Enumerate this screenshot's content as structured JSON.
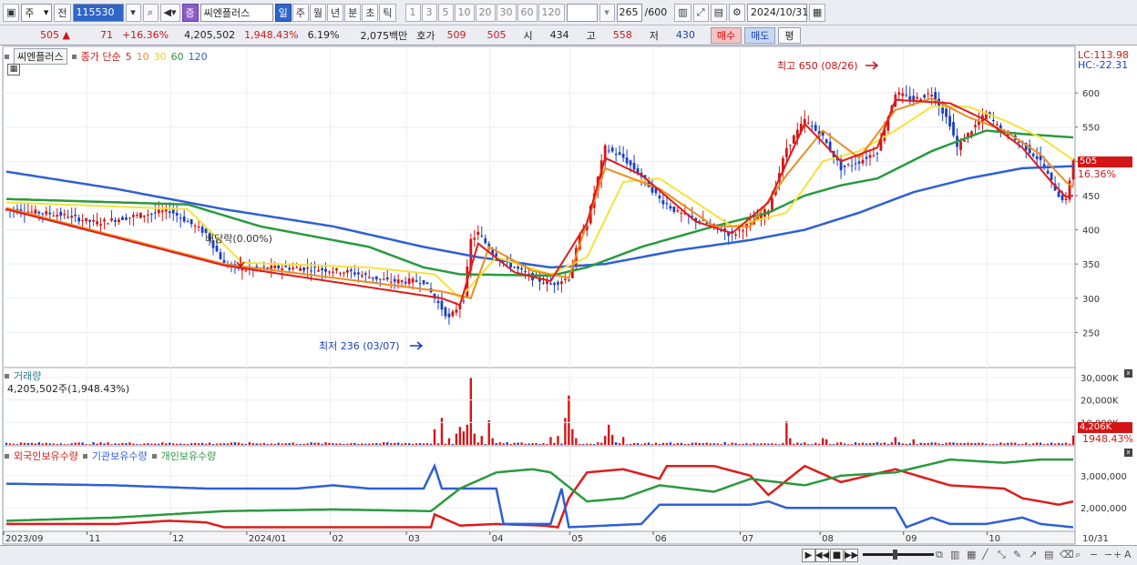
{
  "toolbar": {
    "period_dropdown": "주",
    "prev_label": "전",
    "stock_code": "115530",
    "stock_name": "씨엔플러스",
    "stock_tag": "증",
    "intervals": [
      "일",
      "주",
      "월",
      "년",
      "분",
      "초",
      "틱"
    ],
    "active_interval": "일",
    "ticks": [
      "1",
      "3",
      "5",
      "10",
      "20",
      "30",
      "60",
      "120"
    ],
    "count": "265",
    "count_max": "/600",
    "date": "2024/10/31"
  },
  "quote": {
    "price": "505",
    "change_arrow": "▲",
    "change": "71",
    "change_pct": "+16.36%",
    "volume": "4,205,502",
    "volume_pct": "1,948.43%",
    "turnover_pct": "6.19%",
    "amount": "2,075백만",
    "hoga_label": "호가",
    "hoga_ask": "509",
    "hoga_bid": "505",
    "open_label": "시",
    "open": "434",
    "high_label": "고",
    "high": "558",
    "low_label": "저",
    "low": "430",
    "buy_label": "매수",
    "sell_label": "매도",
    "eval_label": "평"
  },
  "colors": {
    "up": "#d41515",
    "down": "#1a3fc2",
    "ma5": "#e01b1b",
    "ma10": "#f08c1e",
    "ma30": "#f5e23a",
    "ma60": "#2a9a3e",
    "ma120": "#2f5fd6",
    "foreign": "#e01b1b",
    "institution": "#2f5fd6",
    "individual": "#2a9a3e"
  },
  "chart_data": [
    {
      "type": "candlestick",
      "title": "씨엔플러스",
      "legend_label": "종가 단순",
      "ma_periods": [
        "5",
        "10",
        "30",
        "60",
        "120"
      ],
      "x_ticks": [
        "2023/09",
        "11",
        "12",
        "2024/01",
        "02",
        "03",
        "04",
        "05",
        "06",
        "07",
        "08",
        "09",
        "10",
        "10/31"
      ],
      "y_ticks": [
        250,
        300,
        350,
        400,
        450,
        500,
        550,
        600
      ],
      "ylim": [
        200,
        660
      ],
      "side_labels": {
        "lc": "LC:113.98",
        "hc": "HC:-22.31",
        "last_price": "505",
        "last_pct": "16.36%"
      },
      "annotations": {
        "high": "최고 650 (08/26)",
        "low": "최저 236 (03/07)",
        "dividend": "배당락(0.00%)"
      },
      "close_anchors": [
        [
          0,
          430
        ],
        [
          15,
          422
        ],
        [
          25,
          410
        ],
        [
          35,
          420
        ],
        [
          45,
          428
        ],
        [
          55,
          395
        ],
        [
          60,
          350
        ],
        [
          65,
          342
        ],
        [
          75,
          345
        ],
        [
          85,
          343
        ],
        [
          95,
          338
        ],
        [
          105,
          325
        ],
        [
          115,
          325
        ],
        [
          118,
          300
        ],
        [
          122,
          270
        ],
        [
          126,
          300
        ],
        [
          128,
          385
        ],
        [
          130,
          395
        ],
        [
          135,
          360
        ],
        [
          145,
          330
        ],
        [
          150,
          320
        ],
        [
          155,
          330
        ],
        [
          158,
          390
        ],
        [
          160,
          410
        ],
        [
          165,
          520
        ],
        [
          170,
          505
        ],
        [
          175,
          478
        ],
        [
          180,
          445
        ],
        [
          185,
          425
        ],
        [
          190,
          415
        ],
        [
          195,
          405
        ],
        [
          200,
          392
        ],
        [
          205,
          410
        ],
        [
          210,
          430
        ],
        [
          215,
          520
        ],
        [
          220,
          560
        ],
        [
          225,
          535
        ],
        [
          230,
          490
        ],
        [
          235,
          500
        ],
        [
          240,
          515
        ],
        [
          245,
          600
        ],
        [
          250,
          590
        ],
        [
          255,
          600
        ],
        [
          260,
          555
        ],
        [
          262,
          520
        ],
        [
          265,
          540
        ],
        [
          270,
          570
        ],
        [
          275,
          540
        ],
        [
          280,
          525
        ],
        [
          285,
          500
        ],
        [
          290,
          450
        ],
        [
          292,
          442
        ],
        [
          294,
          505
        ]
      ],
      "ma_anchors": {
        "ma5": [
          [
            0,
            430
          ],
          [
            60,
            348
          ],
          [
            120,
            300
          ],
          [
            125,
            290
          ],
          [
            130,
            380
          ],
          [
            140,
            338
          ],
          [
            150,
            325
          ],
          [
            160,
            410
          ],
          [
            165,
            505
          ],
          [
            175,
            480
          ],
          [
            190,
            412
          ],
          [
            200,
            395
          ],
          [
            210,
            440
          ],
          [
            220,
            555
          ],
          [
            230,
            500
          ],
          [
            240,
            520
          ],
          [
            245,
            590
          ],
          [
            260,
            585
          ],
          [
            270,
            560
          ],
          [
            280,
            520
          ],
          [
            288,
            470
          ],
          [
            292,
            448
          ],
          [
            294,
            450
          ]
        ],
        "ma10": [
          [
            0,
            432
          ],
          [
            60,
            350
          ],
          [
            120,
            310
          ],
          [
            128,
            300
          ],
          [
            133,
            375
          ],
          [
            145,
            340
          ],
          [
            155,
            330
          ],
          [
            165,
            490
          ],
          [
            180,
            460
          ],
          [
            195,
            405
          ],
          [
            205,
            405
          ],
          [
            215,
            480
          ],
          [
            225,
            545
          ],
          [
            235,
            505
          ],
          [
            245,
            575
          ],
          [
            255,
            592
          ],
          [
            265,
            565
          ],
          [
            275,
            545
          ],
          [
            285,
            510
          ],
          [
            292,
            470
          ],
          [
            294,
            462
          ]
        ],
        "ma30": [
          [
            0,
            440
          ],
          [
            50,
            430
          ],
          [
            65,
            352
          ],
          [
            100,
            345
          ],
          [
            118,
            335
          ],
          [
            125,
            300
          ],
          [
            135,
            360
          ],
          [
            150,
            335
          ],
          [
            160,
            360
          ],
          [
            170,
            470
          ],
          [
            180,
            475
          ],
          [
            190,
            440
          ],
          [
            200,
            405
          ],
          [
            215,
            425
          ],
          [
            225,
            500
          ],
          [
            235,
            515
          ],
          [
            245,
            545
          ],
          [
            255,
            580
          ],
          [
            265,
            580
          ],
          [
            275,
            560
          ],
          [
            285,
            535
          ],
          [
            294,
            502
          ]
        ],
        "ma60": [
          [
            0,
            445
          ],
          [
            50,
            437
          ],
          [
            70,
            405
          ],
          [
            100,
            375
          ],
          [
            115,
            345
          ],
          [
            125,
            335
          ],
          [
            150,
            333
          ],
          [
            160,
            345
          ],
          [
            175,
            375
          ],
          [
            195,
            405
          ],
          [
            210,
            425
          ],
          [
            220,
            450
          ],
          [
            230,
            465
          ],
          [
            240,
            475
          ],
          [
            255,
            515
          ],
          [
            270,
            545
          ],
          [
            280,
            540
          ],
          [
            294,
            535
          ]
        ],
        "ma120": [
          [
            0,
            485
          ],
          [
            30,
            460
          ],
          [
            60,
            430
          ],
          [
            90,
            405
          ],
          [
            115,
            375
          ],
          [
            130,
            360
          ],
          [
            150,
            345
          ],
          [
            165,
            350
          ],
          [
            185,
            370
          ],
          [
            205,
            385
          ],
          [
            220,
            400
          ],
          [
            235,
            425
          ],
          [
            250,
            455
          ],
          [
            265,
            475
          ],
          [
            280,
            490
          ],
          [
            294,
            493
          ]
        ]
      }
    },
    {
      "type": "bar",
      "title": "거래량",
      "subtitle": "4,205,502주(1,948.43%)",
      "y_ticks": [
        "10,000K",
        "20,000K",
        "30,000K"
      ],
      "ylim": [
        0,
        32000
      ],
      "last_value": "4,206K",
      "last_pct": "1948.43%",
      "spikes": [
        [
          118,
          7000
        ],
        [
          120,
          12000
        ],
        [
          122,
          3000
        ],
        [
          124,
          5000
        ],
        [
          125,
          8000
        ],
        [
          126,
          6000
        ],
        [
          127,
          9000
        ],
        [
          128,
          30000
        ],
        [
          129,
          5000
        ],
        [
          131,
          4000
        ],
        [
          133,
          11000
        ],
        [
          134,
          3000
        ],
        [
          150,
          3500
        ],
        [
          152,
          4000
        ],
        [
          154,
          12000
        ],
        [
          155,
          22000
        ],
        [
          156,
          7000
        ],
        [
          157,
          3000
        ],
        [
          165,
          4000
        ],
        [
          166,
          9000
        ],
        [
          167,
          4500
        ],
        [
          170,
          3500
        ],
        [
          215,
          10500
        ],
        [
          216,
          3000
        ],
        [
          225,
          3000
        ],
        [
          226,
          2500
        ],
        [
          245,
          3500
        ],
        [
          250,
          2500
        ],
        [
          294,
          4200
        ]
      ]
    },
    {
      "type": "line",
      "title": "보유수량",
      "y_ticks": [
        "2,000,000",
        "3,000,000"
      ],
      "ylim": [
        1300000,
        3700000
      ],
      "series": [
        {
          "name": "외국인보유수량",
          "values": [
            [
              0,
              1500000
            ],
            [
              30,
              1500000
            ],
            [
              45,
              1600000
            ],
            [
              55,
              1550000
            ],
            [
              60,
              1400000
            ],
            [
              90,
              1400000
            ],
            [
              117,
              1400000
            ],
            [
              118,
              1800000
            ],
            [
              125,
              1450000
            ],
            [
              135,
              1500000
            ],
            [
              148,
              1450000
            ],
            [
              152,
              1400000
            ],
            [
              155,
              2300000
            ],
            [
              160,
              3100000
            ],
            [
              170,
              3200000
            ],
            [
              180,
              2900000
            ],
            [
              182,
              3300000
            ],
            [
              195,
              3300000
            ],
            [
              205,
              3000000
            ],
            [
              210,
              2400000
            ],
            [
              220,
              3300000
            ],
            [
              230,
              2800000
            ],
            [
              245,
              3200000
            ],
            [
              260,
              2700000
            ],
            [
              275,
              2600000
            ],
            [
              280,
              2300000
            ],
            [
              290,
              2100000
            ],
            [
              294,
              2200000
            ]
          ]
        },
        {
          "name": "기관보유수량",
          "values": [
            [
              0,
              2750000
            ],
            [
              30,
              2700000
            ],
            [
              55,
              2600000
            ],
            [
              80,
              2600000
            ],
            [
              90,
              2700000
            ],
            [
              100,
              2600000
            ],
            [
              115,
              2600000
            ],
            [
              118,
              3300000
            ],
            [
              120,
              2600000
            ],
            [
              135,
              2600000
            ],
            [
              137,
              1500000
            ],
            [
              150,
              1500000
            ],
            [
              153,
              2600000
            ],
            [
              155,
              1400000
            ],
            [
              175,
              1500000
            ],
            [
              180,
              2100000
            ],
            [
              205,
              2100000
            ],
            [
              210,
              2200000
            ],
            [
              215,
              2000000
            ],
            [
              230,
              2000000
            ],
            [
              245,
              2000000
            ],
            [
              248,
              1400000
            ],
            [
              255,
              1700000
            ],
            [
              260,
              1500000
            ],
            [
              270,
              1500000
            ],
            [
              280,
              1700000
            ],
            [
              285,
              1500000
            ],
            [
              294,
              1400000
            ]
          ]
        },
        {
          "name": "개인보유수량",
          "values": [
            [
              0,
              1600000
            ],
            [
              30,
              1700000
            ],
            [
              60,
              1900000
            ],
            [
              90,
              1950000
            ],
            [
              117,
              1900000
            ],
            [
              125,
              2600000
            ],
            [
              135,
              3100000
            ],
            [
              145,
              3200000
            ],
            [
              150,
              3100000
            ],
            [
              160,
              2200000
            ],
            [
              170,
              2300000
            ],
            [
              180,
              2700000
            ],
            [
              195,
              2500000
            ],
            [
              205,
              2900000
            ],
            [
              220,
              2700000
            ],
            [
              230,
              3000000
            ],
            [
              245,
              3100000
            ],
            [
              260,
              3500000
            ],
            [
              275,
              3400000
            ],
            [
              285,
              3500000
            ],
            [
              294,
              3500000
            ]
          ]
        }
      ]
    }
  ]
}
